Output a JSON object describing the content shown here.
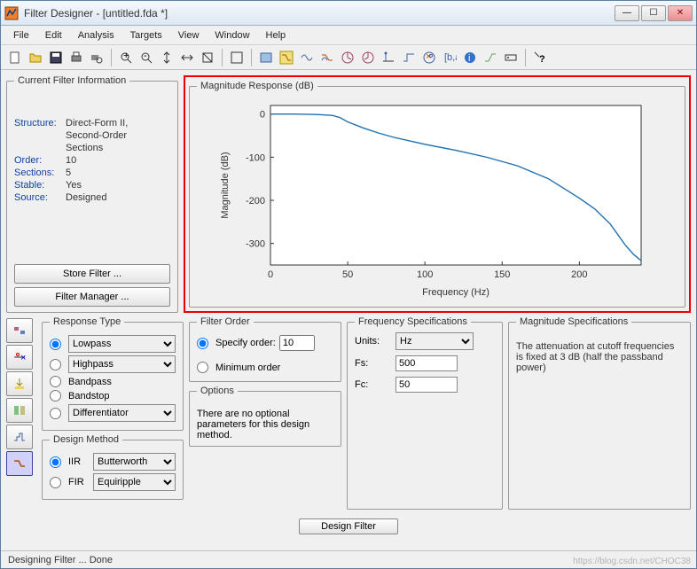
{
  "window": {
    "title": "Filter Designer -  [untitled.fda *]"
  },
  "menu": {
    "file": "File",
    "edit": "Edit",
    "analysis": "Analysis",
    "targets": "Targets",
    "view": "View",
    "window": "Window",
    "help": "Help"
  },
  "filterinfo": {
    "legend": "Current Filter Information",
    "structure_k": "Structure:",
    "structure_v1": "Direct-Form II,",
    "structure_v2": "Second-Order",
    "structure_v3": "Sections",
    "order_k": "Order:",
    "order_v": "10",
    "sections_k": "Sections:",
    "sections_v": "5",
    "stable_k": "Stable:",
    "stable_v": "Yes",
    "source_k": "Source:",
    "source_v": "Designed",
    "store_btn": "Store Filter ...",
    "manager_btn": "Filter Manager ..."
  },
  "magresp": {
    "legend": "Magnitude Response (dB)"
  },
  "chart_data": {
    "type": "line",
    "title": "Magnitude Response (dB)",
    "xlabel": "Frequency (Hz)",
    "ylabel": "Magnitude (dB)",
    "xlim": [
      0,
      240
    ],
    "xticks": [
      0,
      50,
      100,
      150,
      200
    ],
    "ylim": [
      -350,
      20
    ],
    "yticks": [
      0,
      -100,
      -200,
      -300
    ],
    "x": [
      0,
      15,
      30,
      40,
      45,
      50,
      60,
      70,
      80,
      90,
      100,
      120,
      140,
      160,
      180,
      200,
      210,
      220,
      225,
      230,
      235,
      240
    ],
    "values": [
      0,
      0,
      -1,
      -3,
      -8,
      -18,
      -32,
      -44,
      -54,
      -62,
      -70,
      -84,
      -100,
      -120,
      -150,
      -195,
      -220,
      -255,
      -280,
      -305,
      -325,
      -340
    ]
  },
  "resptype": {
    "legend": "Response Type",
    "lowpass": "Lowpass",
    "highpass": "Highpass",
    "bandpass": "Bandpass",
    "bandstop": "Bandstop",
    "differentiator": "Differentiator"
  },
  "designmethod": {
    "legend": "Design Method",
    "iir": "IIR",
    "iir_sel": "Butterworth",
    "fir": "FIR",
    "fir_sel": "Equiripple"
  },
  "filterorder": {
    "legend": "Filter Order",
    "specify": "Specify order:",
    "specify_val": "10",
    "minimum": "Minimum order"
  },
  "options": {
    "legend": "Options",
    "text": "There are no optional parameters for this design method."
  },
  "freqspec": {
    "legend": "Frequency Specifications",
    "units": "Units:",
    "units_val": "Hz",
    "fs": "Fs:",
    "fs_val": "500",
    "fc": "Fc:",
    "fc_val": "50"
  },
  "magspec": {
    "legend": "Magnitude Specifications",
    "text": "The attenuation at cutoff frequencies is fixed at 3 dB (half the passband power)"
  },
  "design_btn": "Design Filter",
  "status": "Designing Filter ... Done",
  "watermark": "https://blog.csdn.net/CHOC38"
}
